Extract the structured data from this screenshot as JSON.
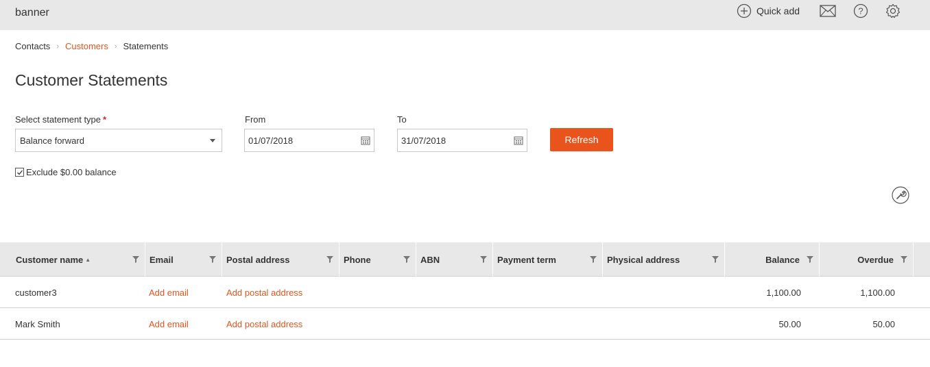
{
  "header": {
    "banner": "banner",
    "quick_add_label": "Quick add",
    "icons": [
      "plus-circle-icon",
      "mail-icon",
      "help-icon",
      "settings-icon"
    ]
  },
  "breadcrumb": {
    "items": [
      "Contacts",
      "Customers",
      "Statements"
    ]
  },
  "page_title": "Customer Statements",
  "form": {
    "statement_type_label": "Select statement type",
    "required_marker": "*",
    "statement_type_value": "Balance forward",
    "from_label": "From",
    "from_value": "01/07/2018",
    "to_label": "To",
    "to_value": "31/07/2018",
    "refresh_label": "Refresh",
    "exclude_zero_label": "Exclude $0.00 balance",
    "exclude_zero_checked": true
  },
  "table": {
    "columns": [
      "Customer name",
      "Email",
      "Postal address",
      "Phone",
      "ABN",
      "Payment term",
      "Physical address",
      "Balance",
      "Overdue"
    ],
    "sort_indicator": "▲",
    "rows": [
      {
        "name": "customer3",
        "email": "Add email",
        "postal": "Add postal address",
        "phone": "",
        "abn": "",
        "term": "",
        "physical": "",
        "balance": "1,100.00",
        "overdue": "1,100.00"
      },
      {
        "name": "Mark Smith",
        "email": "Add email",
        "postal": "Add postal address",
        "phone": "",
        "abn": "",
        "term": "",
        "physical": "",
        "balance": "50.00",
        "overdue": "50.00"
      }
    ]
  },
  "colors": {
    "accent": "#e8541c",
    "header_bg": "#e8e8e8",
    "required": "#d9261c"
  }
}
